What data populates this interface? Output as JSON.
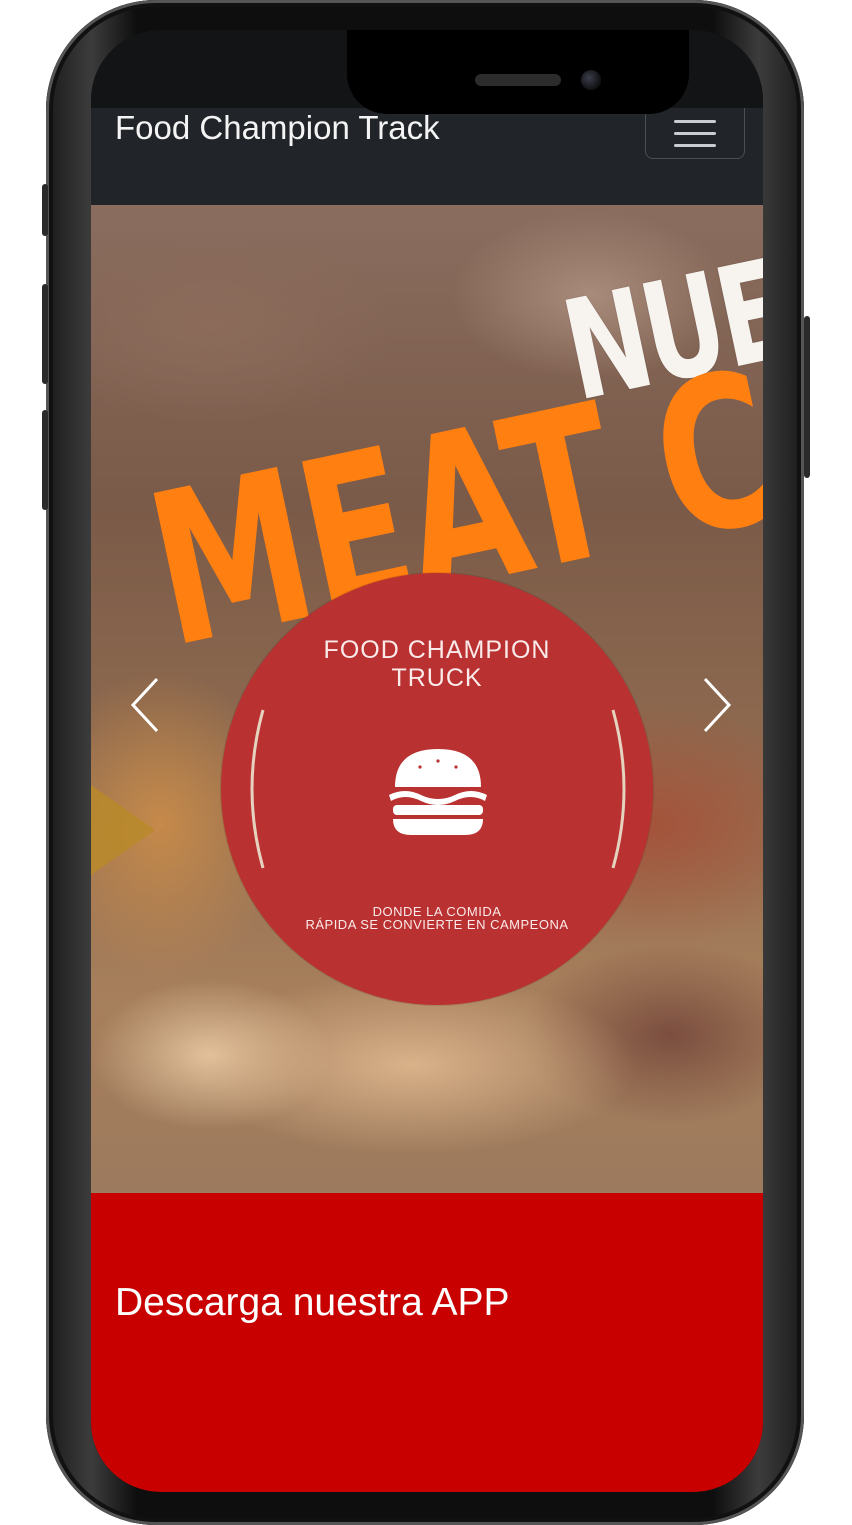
{
  "navbar": {
    "brand": "Food Champion Track",
    "menu_icon": "hamburger-menu-icon"
  },
  "hero": {
    "banner_text_top": "NUEV",
    "banner_text_main": "MEAT C",
    "prev_icon": "chevron-left-icon",
    "next_icon": "chevron-right-icon",
    "colors": {
      "banner_orange": "#ff7f10",
      "banner_white": "#f7f3ef"
    }
  },
  "logo": {
    "title_line1": "FOOD CHAMPION",
    "title_line2": "TRUCK",
    "icon": "burger-icon",
    "tagline_line1": "DONDE LA COMIDA",
    "tagline_line2": "RÁPIDA SE CONVIERTE EN CAMPEONA",
    "color": "#b93131"
  },
  "download": {
    "title": "Descarga nuestra APP",
    "color": "#c80000"
  }
}
